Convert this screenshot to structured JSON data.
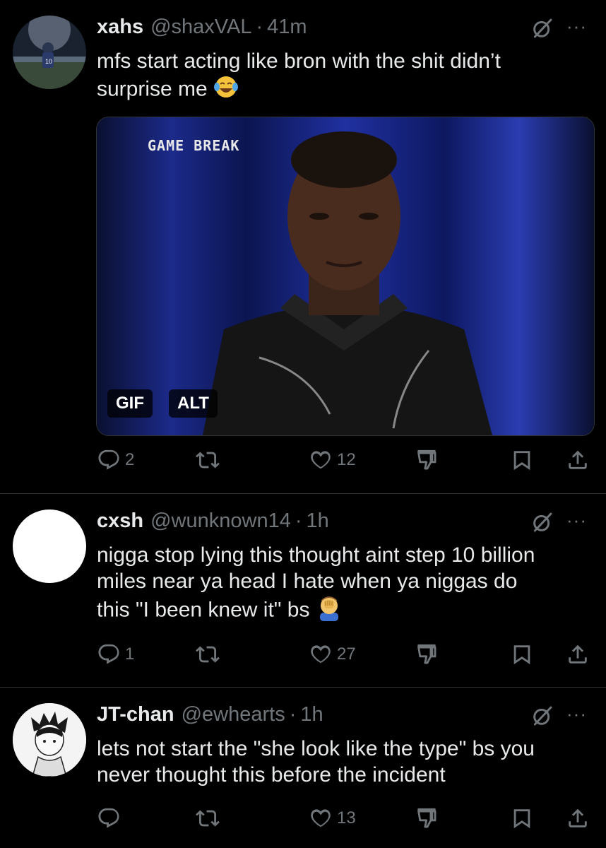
{
  "colors": {
    "background": "#000000",
    "text": "#e7e9ea",
    "secondary": "#71767b",
    "divider": "#2f3336"
  },
  "tweets": [
    {
      "name": "xahs",
      "handle": "@shaxVAL",
      "sep": "·",
      "time": "41m",
      "text": "mfs start acting like bron with the shit didn’t surprise me",
      "emoji": "face-with-tears-of-joy-emoji",
      "media": {
        "caption": "GAME BREAK",
        "gif_label": "GIF",
        "alt_label": "ALT"
      },
      "replies": "2",
      "retweets": "",
      "likes": "12"
    },
    {
      "name": "cxsh",
      "handle": "@wunknown14",
      "sep": "·",
      "time": "1h",
      "text": "nigga stop lying this thought aint step 10 billion miles near ya head I hate when ya niggas do this \"I been knew it\" bs",
      "emoji": "man-facepalming-emoji",
      "replies": "1",
      "retweets": "",
      "likes": "27"
    },
    {
      "name": "JT-chan",
      "handle": "@ewhearts",
      "sep": "·",
      "time": "1h",
      "text": "lets not start the \"she look like the type\" bs you never thought this before the incident",
      "replies": "",
      "retweets": "",
      "likes": "13"
    }
  ],
  "more_label": "···"
}
